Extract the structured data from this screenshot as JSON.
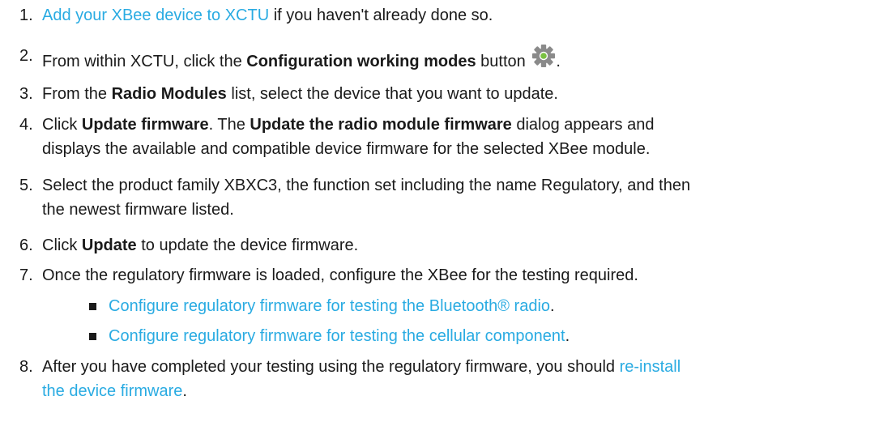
{
  "steps": [
    {
      "number": "1.",
      "link": "Add your XBee device to XCTU",
      "rest": " if you haven't already done so."
    },
    {
      "number": "2.",
      "pre": "From within XCTU, click the ",
      "bold": "Configuration working modes",
      "post": " button",
      "icon": "gear-icon",
      "end": "."
    },
    {
      "number": "3.",
      "pre": "From the ",
      "bold": "Radio Modules",
      "post": " list, select the device that you want to update."
    },
    {
      "number": "4.",
      "pre": "Click ",
      "bold1": "Update firmware",
      "mid": ". The ",
      "bold2": "Update the radio module firmware",
      "post_line1": " dialog appears and",
      "line2": "displays the available and compatible device firmware for the selected XBee module."
    },
    {
      "number": "5.",
      "line1": "Select the product family XBXC3, the function set including the name Regulatory, and then",
      "line2": "the newest firmware listed."
    },
    {
      "number": "6.",
      "pre": "Click ",
      "bold": "Update",
      "post": " to update the device firmware."
    },
    {
      "number": "7.",
      "text": "Once the regulatory firmware is loaded, configure the XBee for the testing required.",
      "subitems": [
        {
          "link": "Configure regulatory firmware for testing the Bluetooth® radio",
          "end": "."
        },
        {
          "link": "Configure regulatory firmware for testing the cellular component",
          "end": "."
        }
      ]
    },
    {
      "number": "8.",
      "pre": "After you have completed your testing using the regulatory firmware, you should ",
      "link_line1": "re-install",
      "link_line2": "the device firmware",
      "end": "."
    }
  ],
  "colors": {
    "link": "#29abe2",
    "text": "#1a1a1a",
    "gear_body": "#8a8a8a",
    "gear_center": "#7ac142"
  }
}
